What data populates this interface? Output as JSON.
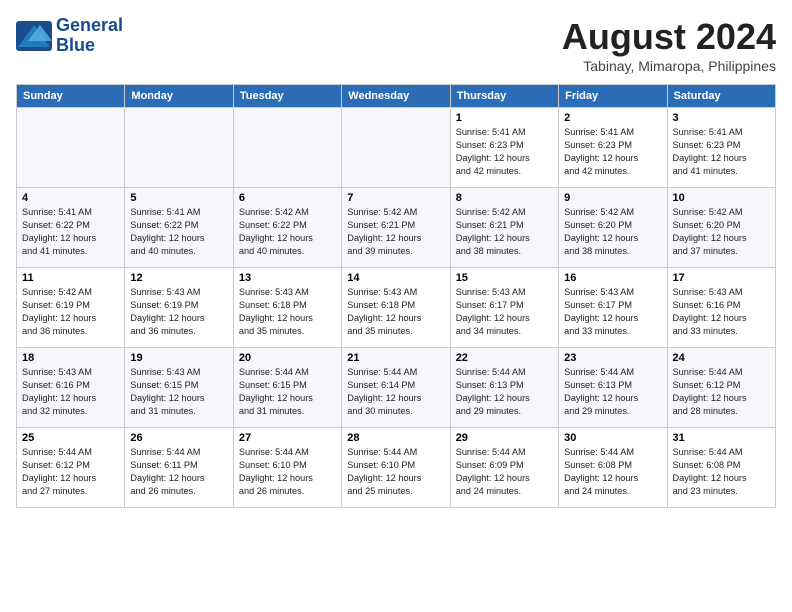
{
  "header": {
    "logo_line1": "General",
    "logo_line2": "Blue",
    "month_year": "August 2024",
    "location": "Tabinay, Mimaropa, Philippines"
  },
  "weekdays": [
    "Sunday",
    "Monday",
    "Tuesday",
    "Wednesday",
    "Thursday",
    "Friday",
    "Saturday"
  ],
  "weeks": [
    [
      {
        "day": "",
        "info": ""
      },
      {
        "day": "",
        "info": ""
      },
      {
        "day": "",
        "info": ""
      },
      {
        "day": "",
        "info": ""
      },
      {
        "day": "1",
        "info": "Sunrise: 5:41 AM\nSunset: 6:23 PM\nDaylight: 12 hours\nand 42 minutes."
      },
      {
        "day": "2",
        "info": "Sunrise: 5:41 AM\nSunset: 6:23 PM\nDaylight: 12 hours\nand 42 minutes."
      },
      {
        "day": "3",
        "info": "Sunrise: 5:41 AM\nSunset: 6:23 PM\nDaylight: 12 hours\nand 41 minutes."
      }
    ],
    [
      {
        "day": "4",
        "info": "Sunrise: 5:41 AM\nSunset: 6:22 PM\nDaylight: 12 hours\nand 41 minutes."
      },
      {
        "day": "5",
        "info": "Sunrise: 5:41 AM\nSunset: 6:22 PM\nDaylight: 12 hours\nand 40 minutes."
      },
      {
        "day": "6",
        "info": "Sunrise: 5:42 AM\nSunset: 6:22 PM\nDaylight: 12 hours\nand 40 minutes."
      },
      {
        "day": "7",
        "info": "Sunrise: 5:42 AM\nSunset: 6:21 PM\nDaylight: 12 hours\nand 39 minutes."
      },
      {
        "day": "8",
        "info": "Sunrise: 5:42 AM\nSunset: 6:21 PM\nDaylight: 12 hours\nand 38 minutes."
      },
      {
        "day": "9",
        "info": "Sunrise: 5:42 AM\nSunset: 6:20 PM\nDaylight: 12 hours\nand 38 minutes."
      },
      {
        "day": "10",
        "info": "Sunrise: 5:42 AM\nSunset: 6:20 PM\nDaylight: 12 hours\nand 37 minutes."
      }
    ],
    [
      {
        "day": "11",
        "info": "Sunrise: 5:42 AM\nSunset: 6:19 PM\nDaylight: 12 hours\nand 36 minutes."
      },
      {
        "day": "12",
        "info": "Sunrise: 5:43 AM\nSunset: 6:19 PM\nDaylight: 12 hours\nand 36 minutes."
      },
      {
        "day": "13",
        "info": "Sunrise: 5:43 AM\nSunset: 6:18 PM\nDaylight: 12 hours\nand 35 minutes."
      },
      {
        "day": "14",
        "info": "Sunrise: 5:43 AM\nSunset: 6:18 PM\nDaylight: 12 hours\nand 35 minutes."
      },
      {
        "day": "15",
        "info": "Sunrise: 5:43 AM\nSunset: 6:17 PM\nDaylight: 12 hours\nand 34 minutes."
      },
      {
        "day": "16",
        "info": "Sunrise: 5:43 AM\nSunset: 6:17 PM\nDaylight: 12 hours\nand 33 minutes."
      },
      {
        "day": "17",
        "info": "Sunrise: 5:43 AM\nSunset: 6:16 PM\nDaylight: 12 hours\nand 33 minutes."
      }
    ],
    [
      {
        "day": "18",
        "info": "Sunrise: 5:43 AM\nSunset: 6:16 PM\nDaylight: 12 hours\nand 32 minutes."
      },
      {
        "day": "19",
        "info": "Sunrise: 5:43 AM\nSunset: 6:15 PM\nDaylight: 12 hours\nand 31 minutes."
      },
      {
        "day": "20",
        "info": "Sunrise: 5:44 AM\nSunset: 6:15 PM\nDaylight: 12 hours\nand 31 minutes."
      },
      {
        "day": "21",
        "info": "Sunrise: 5:44 AM\nSunset: 6:14 PM\nDaylight: 12 hours\nand 30 minutes."
      },
      {
        "day": "22",
        "info": "Sunrise: 5:44 AM\nSunset: 6:13 PM\nDaylight: 12 hours\nand 29 minutes."
      },
      {
        "day": "23",
        "info": "Sunrise: 5:44 AM\nSunset: 6:13 PM\nDaylight: 12 hours\nand 29 minutes."
      },
      {
        "day": "24",
        "info": "Sunrise: 5:44 AM\nSunset: 6:12 PM\nDaylight: 12 hours\nand 28 minutes."
      }
    ],
    [
      {
        "day": "25",
        "info": "Sunrise: 5:44 AM\nSunset: 6:12 PM\nDaylight: 12 hours\nand 27 minutes."
      },
      {
        "day": "26",
        "info": "Sunrise: 5:44 AM\nSunset: 6:11 PM\nDaylight: 12 hours\nand 26 minutes."
      },
      {
        "day": "27",
        "info": "Sunrise: 5:44 AM\nSunset: 6:10 PM\nDaylight: 12 hours\nand 26 minutes."
      },
      {
        "day": "28",
        "info": "Sunrise: 5:44 AM\nSunset: 6:10 PM\nDaylight: 12 hours\nand 25 minutes."
      },
      {
        "day": "29",
        "info": "Sunrise: 5:44 AM\nSunset: 6:09 PM\nDaylight: 12 hours\nand 24 minutes."
      },
      {
        "day": "30",
        "info": "Sunrise: 5:44 AM\nSunset: 6:08 PM\nDaylight: 12 hours\nand 24 minutes."
      },
      {
        "day": "31",
        "info": "Sunrise: 5:44 AM\nSunset: 6:08 PM\nDaylight: 12 hours\nand 23 minutes."
      }
    ]
  ]
}
